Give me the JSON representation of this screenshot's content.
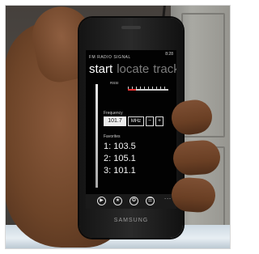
{
  "status": {
    "time": "8:28"
  },
  "app": {
    "title": "FM RADIO SIGNAL"
  },
  "pivot": {
    "items": [
      "start",
      "locate",
      "track"
    ]
  },
  "signal": {
    "rssi_label": "RSSI"
  },
  "tuner": {
    "frequency_label": "Frequency",
    "frequency_value": "101.7",
    "unit": "MHz",
    "minus": "−",
    "plus": "+"
  },
  "favorites": {
    "label": "Favorites",
    "items": [
      "1: 103.5",
      "2: 105.1",
      "3: 101.1"
    ]
  },
  "appbar": {
    "icons": [
      "play-icon",
      "star-icon",
      "favorite-icon",
      "list-icon"
    ],
    "glyphs": [
      "▶",
      "★",
      "✪",
      "☰"
    ],
    "more": "..."
  },
  "phone": {
    "brand": "SAMSUNG"
  }
}
